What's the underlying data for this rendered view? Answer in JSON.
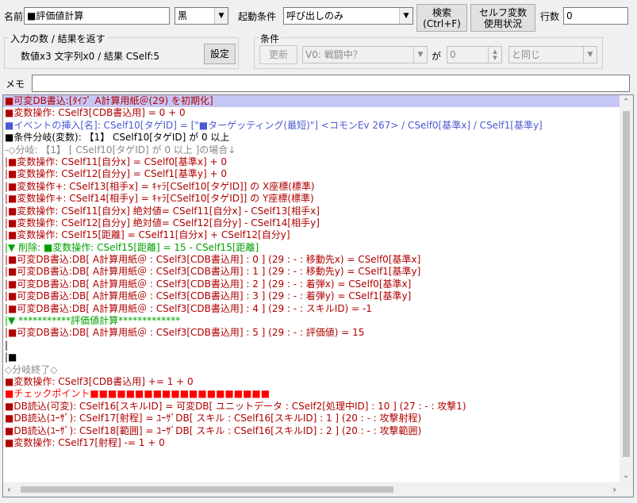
{
  "header": {
    "name_label": "名前",
    "name_value": "■評価値計算",
    "color_value": "黒",
    "trigger_label": "起動条件",
    "trigger_value": "呼び出しのみ",
    "search_line1": "検索",
    "search_line2": "(Ctrl+F)",
    "selfvar_line1": "セルフ変数",
    "selfvar_line2": "使用状況",
    "linecount_label": "行数",
    "linecount_value": "0"
  },
  "io_group": {
    "title": "入力の数 / 結果を返す",
    "summary": "数値x3 文字列x0 / 結果 CSelf:5",
    "set_button": "設定"
  },
  "condition_group": {
    "title": "条件",
    "update_button": "更新",
    "var_value": "V0: 戦闘中？",
    "ga_label": "が",
    "num_value": "0",
    "compare_value": "と同じ"
  },
  "memo": {
    "label": "メモ",
    "value": ""
  },
  "colors": {
    "red": "#b00000",
    "blue": "#4a5ad0",
    "black": "#000000",
    "gray": "#888888",
    "green": "#00a000",
    "hotred": "#ff0000",
    "selection": "#c6c6f5"
  },
  "code_lines": [
    {
      "text": "■可変DB書込:[ﾀｲﾌﾟ A計算用紙＠(29) を初期化]",
      "color": "#b00000",
      "selected": true
    },
    {
      "text": "■変数操作: CSelf3[CDB書込用] = 0 + 0",
      "color": "#b00000"
    },
    {
      "text": "■イベントの挿入[名]: CSelf10[タゲID] = [\"■ターゲッティング(最短)\"] <コモンEv 267>  / CSelf0[基準x] / CSelf1[基準y]",
      "color": "#4a5ad0"
    },
    {
      "text": "■条件分岐(変数): 【1】 CSelf10[タゲID]  が  0 以上",
      "color": "#000000"
    },
    {
      "text": "-◇分岐: 【1】 [ CSelf10[タゲID]  が  0 以上  ]の場合↓",
      "color": "#888888"
    },
    {
      "text": " |■変数操作: CSelf11[自分x] = CSelf0[基準x] + 0",
      "color": "#b00000"
    },
    {
      "text": " |■変数操作: CSelf12[自分y] = CSelf1[基準y] + 0",
      "color": "#b00000"
    },
    {
      "text": " |■変数操作+: CSelf13[相手x] = ｷｬﾗ[CSelf10[タゲID]] の X座標(標準)",
      "color": "#b00000"
    },
    {
      "text": " |■変数操作+: CSelf14[相手y] = ｷｬﾗ[CSelf10[タゲID]] の Y座標(標準)",
      "color": "#b00000"
    },
    {
      "text": " |■変数操作: CSelf11[自分x] 絶対値= CSelf11[自分x] - CSelf13[相手x]",
      "color": "#b00000"
    },
    {
      "text": " |■変数操作: CSelf12[自分y] 絶対値= CSelf12[自分y] - CSelf14[相手y]",
      "color": "#b00000"
    },
    {
      "text": " |■変数操作: CSelf15[距離] = CSelf11[自分x] + CSelf12[自分y]",
      "color": "#b00000"
    },
    {
      "text": " |▼ 削除: ■変数操作: CSelf15[距離] = 15 - CSelf15[距離]",
      "color": "#00a000"
    },
    {
      "text": " |■可変DB書込:DB[ A計算用紙＠ : CSelf3[CDB書込用] : 0 ]  (29 : - : 移動先x) =  CSelf0[基準x]",
      "color": "#b00000"
    },
    {
      "text": " |■可変DB書込:DB[ A計算用紙＠ : CSelf3[CDB書込用] : 1 ]  (29 : - : 移動先y) =  CSelf1[基準y]",
      "color": "#b00000"
    },
    {
      "text": " |■可変DB書込:DB[ A計算用紙＠ : CSelf3[CDB書込用] : 2 ]  (29 : - : 着弾x) =  CSelf0[基準x]",
      "color": "#b00000"
    },
    {
      "text": " |■可変DB書込:DB[ A計算用紙＠ : CSelf3[CDB書込用] : 3 ]  (29 : - : 着弾y) =  CSelf1[基準y]",
      "color": "#b00000"
    },
    {
      "text": " |■可変DB書込:DB[ A計算用紙＠ : CSelf3[CDB書込用] : 4 ]  (29 : - : スキルID) =  -1",
      "color": "#b00000"
    },
    {
      "text": " |▼ ***********評価値計算*************",
      "color": "#00a000"
    },
    {
      "text": " |■可変DB書込:DB[ A計算用紙＠ : CSelf3[CDB書込用] : 5 ]  (29 : - : 評価値) =  15",
      "color": "#b00000"
    },
    {
      "text": " |",
      "color": "#000000"
    },
    {
      "text": " |■",
      "color": "#000000"
    },
    {
      "text": "◇分岐終了◇",
      "color": "#888888"
    },
    {
      "text": "■変数操作: CSelf3[CDB書込用] += 1 + 0",
      "color": "#b00000"
    },
    {
      "text": "■チェックポイント■■■■■■■■■■■■■■■■■■■■",
      "color": "#ff0000"
    },
    {
      "text": "■DB読込(可変): CSelf16[スキルID] = 可変DB[ ユニットデータ : CSelf2[処理中ID] : 10 ]  (27 : - : 攻撃1)",
      "color": "#b00000"
    },
    {
      "text": "■DB読込(ﾕｰｻﾞ): CSelf17[射程] = ﾕｰｻﾞDB[ スキル : CSelf16[スキルID] : 1 ]  (20 : - : 攻撃射程)",
      "color": "#b00000"
    },
    {
      "text": "■DB読込(ﾕｰｻﾞ): CSelf18[範囲] = ﾕｰｻﾞDB[ スキル : CSelf16[スキルID] : 2 ]  (20 : - : 攻撃範囲)",
      "color": "#b00000"
    },
    {
      "text": "■変数操作: CSelf17[射程] -= 1 + 0",
      "color": "#b00000"
    }
  ]
}
